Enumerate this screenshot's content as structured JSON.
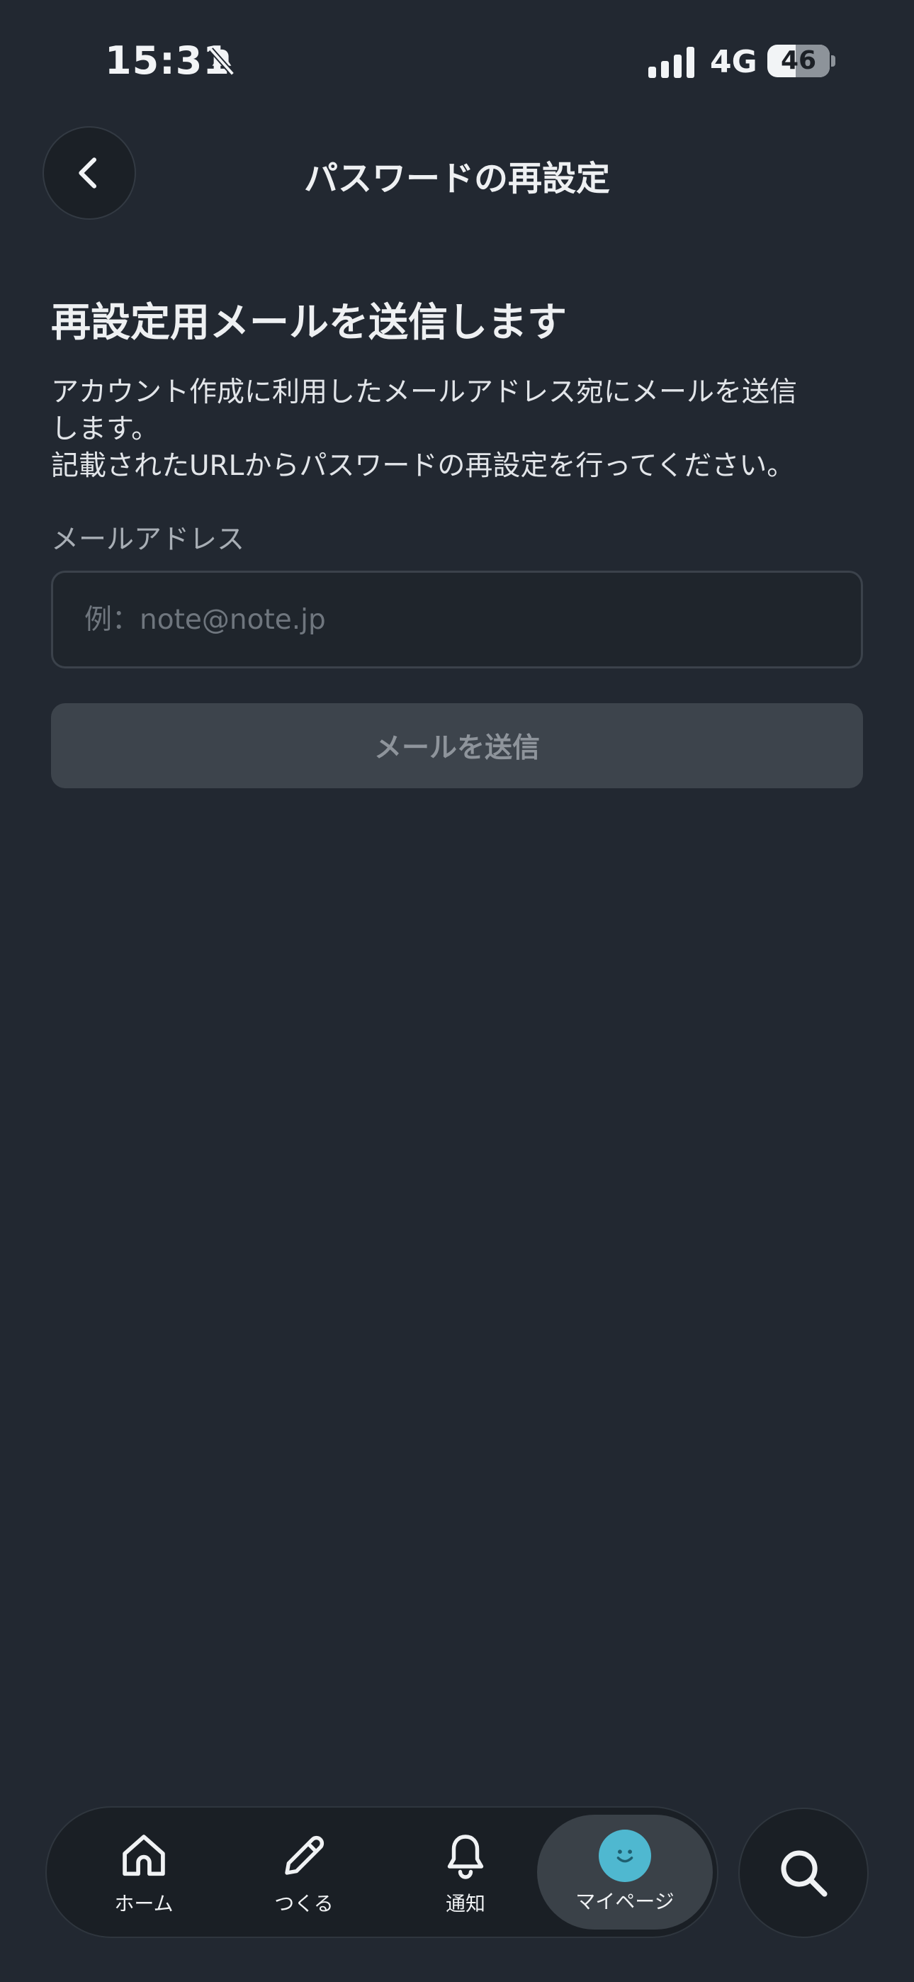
{
  "status_bar": {
    "time": "15:31",
    "network": "4G",
    "battery": "46",
    "icons": [
      "bell-slash-icon",
      "cellular-signal-icon",
      "battery-icon"
    ]
  },
  "header": {
    "title": "パスワードの再設定",
    "back_icon": "chevron-left-icon"
  },
  "main": {
    "heading": "再設定用メールを送信します",
    "description": [
      "アカウント作成に利用したメールアドレス宛にメールを送信",
      "します。",
      "記載されたURLからパスワードの再設定を行ってください。"
    ],
    "email_label": "メールアドレス",
    "email_placeholder": "例：note@note.jp",
    "email_value": "",
    "send_button_label": "メールを送信",
    "send_button_disabled": true
  },
  "bottom_nav": {
    "tabs": [
      {
        "label": "ホーム",
        "icon": "home-icon",
        "active": false
      },
      {
        "label": "つくる",
        "icon": "pencil-icon",
        "active": false
      },
      {
        "label": "通知",
        "icon": "bell-icon",
        "active": false
      },
      {
        "label": "マイページ",
        "icon": "avatar-icon",
        "active": true
      }
    ],
    "search_icon": "search-icon"
  },
  "colors": {
    "background": "#222831",
    "avatar": "#4fb8d0",
    "disabled_button": "#3d444c"
  }
}
